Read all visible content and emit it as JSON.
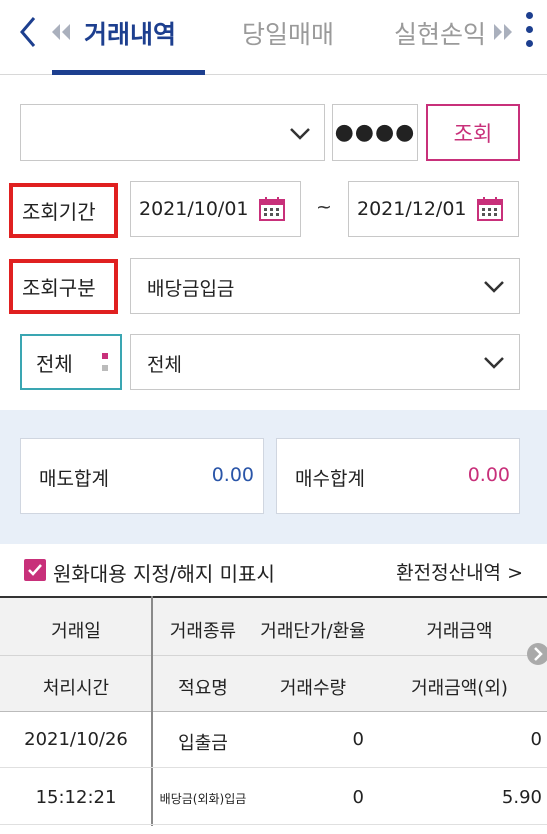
{
  "header": {
    "tabs": [
      {
        "label": "거래내역",
        "active": true
      },
      {
        "label": "당일매매",
        "active": false
      },
      {
        "label": "실현손익",
        "active": false
      }
    ],
    "icons": [
      "chevron-left-icon",
      "double-chevron-left-icon",
      "double-chevron-right-icon",
      "more-vertical-icon"
    ]
  },
  "account": {
    "selected": "",
    "password_mask": "●●●●",
    "search_label": "조회"
  },
  "period": {
    "label": "조회기간",
    "from": "2021/10/01",
    "separator": "~",
    "to": "2021/12/01"
  },
  "category": {
    "label": "조회구분",
    "value": "배당금입금"
  },
  "filter": {
    "left_value": "전체",
    "right_value": "전체"
  },
  "summary": {
    "sell_label": "매도합계",
    "sell_value": "0.00",
    "buy_label": "매수합계",
    "buy_value": "0.00"
  },
  "options": {
    "checkbox_label": "원화대용 지정/해지 미표시",
    "checked": true,
    "link_label": "환전정산내역 >"
  },
  "table": {
    "headers_row1": [
      "거래일",
      "거래종류",
      "거래단가/환율",
      "거래금액"
    ],
    "headers_row2": [
      "처리시간",
      "적요명",
      "거래수량",
      "거래금액(외)"
    ],
    "rows": [
      {
        "date": "2021/10/26",
        "type": "입출금",
        "price": "0",
        "amount": "0"
      },
      {
        "time": "15:12:21",
        "memo": "배당금(외화)입금",
        "qty": "0",
        "amount_fx": "5.90"
      }
    ]
  },
  "colors": {
    "brand_navy": "#1d3f8f",
    "accent_pink": "#c8307a",
    "sell_blue": "#2a55a8",
    "highlight_red": "#e02020",
    "teal": "#3aa6b2"
  }
}
